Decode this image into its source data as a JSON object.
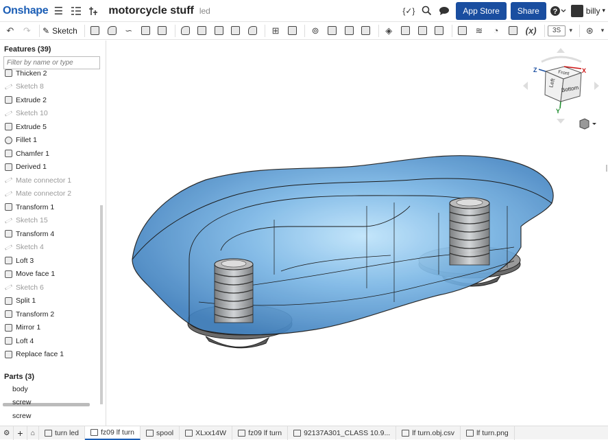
{
  "header": {
    "logo": "Onshape",
    "doc_title": "motorcycle stuff",
    "doc_subtitle": "led",
    "app_store_label": "App Store",
    "share_label": "Share",
    "user_name": "billy"
  },
  "toolbar": {
    "sketch_label": "Sketch",
    "fx_label": "(x)",
    "view_label": "3S"
  },
  "features": {
    "header": "Features (39)",
    "filter_placeholder": "Filter by name or type",
    "items": [
      {
        "label": "Thicken 2",
        "suppressed": false
      },
      {
        "label": "Sketch 8",
        "suppressed": true
      },
      {
        "label": "Extrude 2",
        "suppressed": false
      },
      {
        "label": "Sketch 10",
        "suppressed": true
      },
      {
        "label": "Extrude 5",
        "suppressed": false
      },
      {
        "label": "Fillet 1",
        "suppressed": false
      },
      {
        "label": "Chamfer 1",
        "suppressed": false
      },
      {
        "label": "Derived 1",
        "suppressed": false
      },
      {
        "label": "Mate connector 1",
        "suppressed": true
      },
      {
        "label": "Mate connector 2",
        "suppressed": true
      },
      {
        "label": "Transform 1",
        "suppressed": false
      },
      {
        "label": "Sketch 15",
        "suppressed": true
      },
      {
        "label": "Transform 4",
        "suppressed": false
      },
      {
        "label": "Sketch 4",
        "suppressed": true
      },
      {
        "label": "Loft 3",
        "suppressed": false
      },
      {
        "label": "Move face 1",
        "suppressed": false
      },
      {
        "label": "Sketch 6",
        "suppressed": true
      },
      {
        "label": "Split 1",
        "suppressed": false
      },
      {
        "label": "Transform 2",
        "suppressed": false
      },
      {
        "label": "Mirror 1",
        "suppressed": false
      },
      {
        "label": "Loft 4",
        "suppressed": false
      },
      {
        "label": "Replace face 1",
        "suppressed": false
      }
    ]
  },
  "parts": {
    "header": "Parts (3)",
    "items": [
      "body",
      "screw",
      "screw"
    ]
  },
  "view_cube": {
    "top_label": "Front",
    "left_label": "Left",
    "bottom_label": "Bottom",
    "axis_x": "X",
    "axis_y": "Y",
    "axis_z": "Z"
  },
  "tabs": [
    {
      "label": "turn led",
      "active": false
    },
    {
      "label": "fz09 lf turn",
      "active": true
    },
    {
      "label": "spool",
      "active": false
    },
    {
      "label": "XLxx14W",
      "active": false
    },
    {
      "label": "fz09 lf turn",
      "active": false
    },
    {
      "label": "92137A301_CLASS 10.9...",
      "active": false
    },
    {
      "label": "lf turn.obj.csv",
      "active": false
    },
    {
      "label": "lf turn.png",
      "active": false
    }
  ],
  "colors": {
    "accent": "#1a4ea0",
    "model_blue": "#5a9fd4",
    "screw_gray": "#9a9a9a"
  }
}
